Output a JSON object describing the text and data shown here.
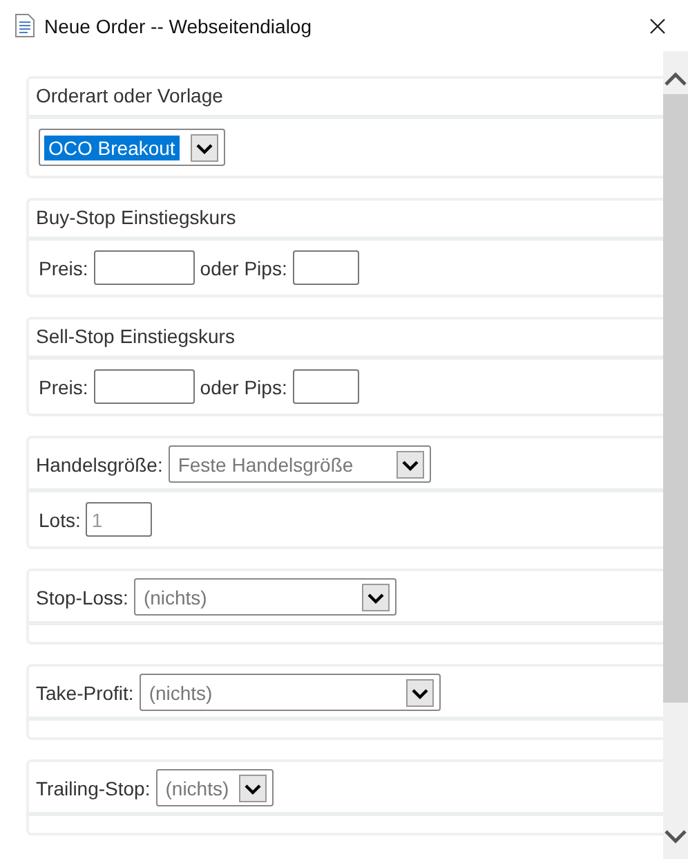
{
  "window": {
    "title": "Neue Order -- Webseitendialog"
  },
  "sections": [
    {
      "kind": "template",
      "title": "Orderart oder Vorlage",
      "select": {
        "value": "OCO Breakout",
        "highlighted": true
      }
    },
    {
      "kind": "entry",
      "title": "Buy-Stop Einstiegskurs",
      "price_label": "Preis:",
      "pips_label": "oder Pips:"
    },
    {
      "kind": "entry",
      "title": "Sell-Stop Einstiegskurs",
      "price_label": "Preis:",
      "pips_label": "oder Pips:"
    },
    {
      "kind": "size",
      "label": "Handelsgröße:",
      "select": {
        "value": "Feste Handelsgröße",
        "highlighted": false
      },
      "lots_label": "Lots:",
      "lots_placeholder": "1"
    },
    {
      "kind": "select",
      "label": "Stop-Loss:",
      "select": {
        "value": "(nichts)",
        "highlighted": false
      }
    },
    {
      "kind": "select",
      "label": "Take-Profit:",
      "select": {
        "value": "(nichts)",
        "highlighted": false
      }
    },
    {
      "kind": "select",
      "label": "Trailing-Stop:",
      "select": {
        "value": "(nichts)",
        "highlighted": false
      }
    }
  ]
}
